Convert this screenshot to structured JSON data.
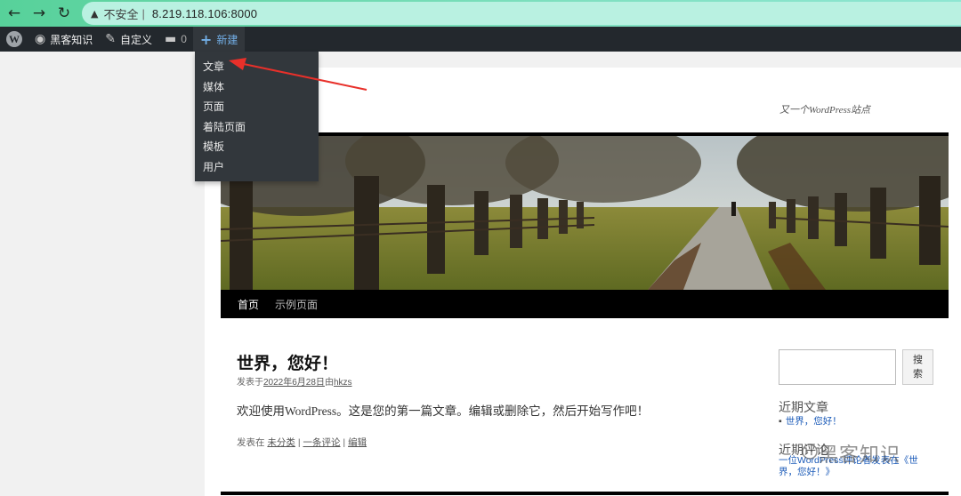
{
  "browser": {
    "back_icon": "arrow-left-icon",
    "forward_icon": "arrow-right-icon",
    "reload_icon": "reload-icon",
    "security_label": "不安全",
    "separator": "|",
    "url": "8.219.118.106:8000"
  },
  "admin_bar": {
    "wp_logo": "W",
    "site_name": "黑客知识",
    "customize": "自定义",
    "comments_count": "0",
    "new": "新建"
  },
  "new_menu": {
    "items": [
      "文章",
      "媒体",
      "页面",
      "着陆页面",
      "模板",
      "用户"
    ]
  },
  "site": {
    "tagline": "又一个WordPress站点",
    "nav": [
      "首页",
      "示例页面"
    ],
    "post": {
      "title": "世界，您好！",
      "meta_prefix": "发表于",
      "date": "2022年6月28日",
      "by": "由",
      "author": "hkzs",
      "body": "欢迎使用WordPress。这是您的第一篇文章。编辑或删除它，然后开始写作吧！",
      "footer_prefix": "发表在",
      "category": "未分类",
      "comment_link": "一条评论",
      "edit_link": "编辑",
      "pipe": "|"
    },
    "sidebar": {
      "search_button": "搜索",
      "recent_posts_title": "近期文章",
      "recent_post": "世界，您好！",
      "recent_comments_title": "近期评论",
      "recent_comment": "一位WordPress评论者发表在《世界，您好！》"
    },
    "watermark": "黑客知识"
  },
  "colors": {
    "admin_bar": "#23282d",
    "dropdown": "#32373c",
    "link_blue": "#72aee6",
    "annotation_red": "#e8302a"
  }
}
